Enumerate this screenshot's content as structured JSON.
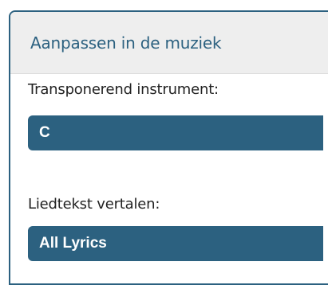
{
  "panel": {
    "title": "Aanpassen in de muziek"
  },
  "transpose": {
    "label": "Transponerend instrument:",
    "selected": "C"
  },
  "lyrics": {
    "label": "Liedtekst vertalen:",
    "selected": "All Lyrics"
  },
  "colors": {
    "accent": "#2c6180",
    "header_bg": "#eeeeee"
  }
}
